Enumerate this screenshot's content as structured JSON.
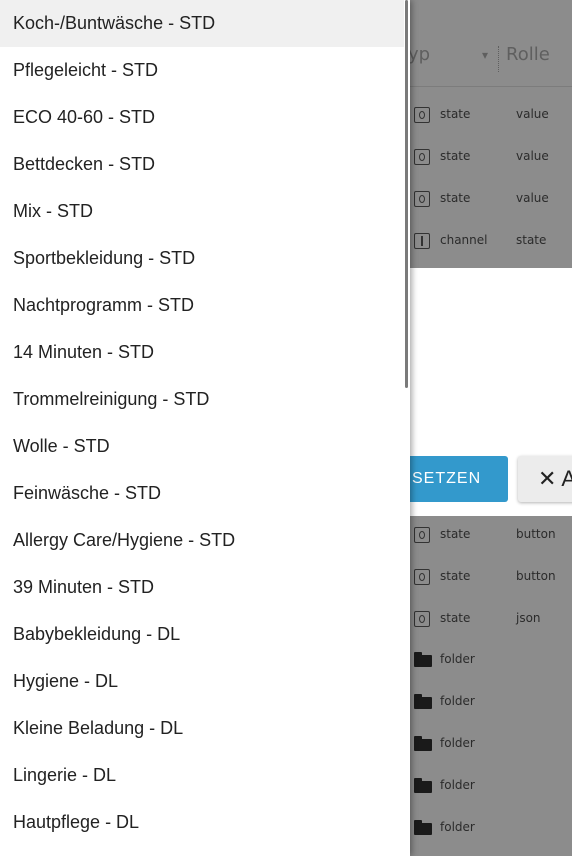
{
  "table": {
    "header": {
      "typ_label": "yp",
      "sort_arrow": "▾",
      "rolle_label": "Rolle"
    },
    "rows_top": [
      {
        "type": "state",
        "role": "value",
        "icon": "state-icon"
      },
      {
        "type": "state",
        "role": "value",
        "icon": "state-icon"
      },
      {
        "type": "state",
        "role": "value",
        "icon": "state-icon"
      },
      {
        "type": "channel",
        "role": "state",
        "icon": "channel-icon"
      }
    ],
    "rows_bottom": [
      {
        "type": "state",
        "role": "button",
        "icon": "state-icon"
      },
      {
        "type": "state",
        "role": "button",
        "icon": "state-icon"
      },
      {
        "type": "state",
        "role": "json",
        "icon": "state-icon"
      },
      {
        "type": "folder",
        "role": "",
        "icon": "folder-icon"
      },
      {
        "type": "folder",
        "role": "",
        "icon": "folder-icon"
      },
      {
        "type": "folder",
        "role": "",
        "icon": "folder-icon"
      },
      {
        "type": "folder",
        "role": "",
        "icon": "folder-icon"
      },
      {
        "type": "folder",
        "role": "",
        "icon": "folder-icon"
      }
    ]
  },
  "dialog": {
    "set_button_label": "SETZEN",
    "cancel_button_label": "✕ A"
  },
  "menu": {
    "selected_index": 0,
    "items": [
      "Koch-/Buntwäsche - STD",
      "Pflegeleicht - STD",
      "ECO 40-60 - STD",
      "Bettdecken - STD",
      "Mix - STD",
      "Sportbekleidung - STD",
      "Nachtprogramm - STD",
      "14 Minuten - STD",
      "Trommelreinigung - STD",
      "Wolle - STD",
      "Feinwäsche - STD",
      "Allergy Care/Hygiene - STD",
      "39 Minuten - STD",
      "Babybekleidung - DL",
      "Hygiene - DL",
      "Kleine Beladung - DL",
      "Lingerie - DL",
      "Hautpflege - DL"
    ]
  },
  "colors": {
    "accent": "#3399cc",
    "overlay": "#8c8c8c",
    "selected_bg": "#f0f0f0"
  }
}
